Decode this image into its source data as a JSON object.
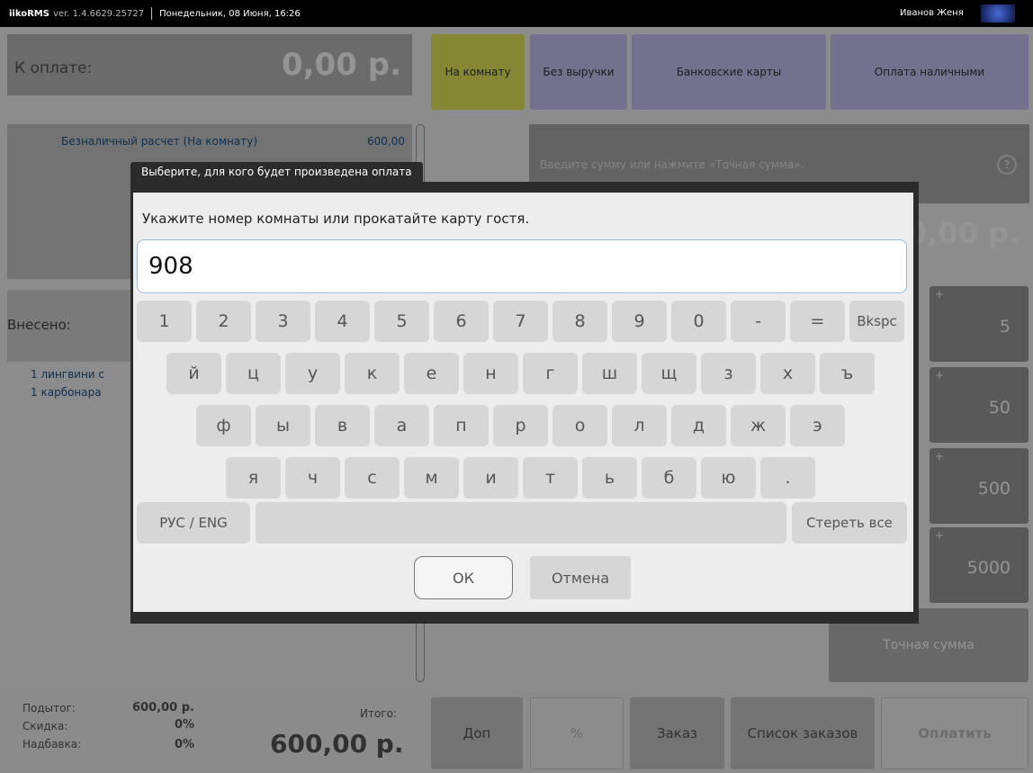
{
  "titlebar": {
    "app": "iikoRMS",
    "version": "ver. 1.4.6629.25727",
    "datetime": "Понедельник, 08 Июня, 16:26",
    "user": "Иванов Женя"
  },
  "payment": {
    "due_label": "К оплате:",
    "due_value": "0,00 р.",
    "methods": [
      "На комнату",
      "Без выручки",
      "Банковские карты",
      "Оплата наличными"
    ],
    "line_label": "Безналичный расчет (На комнату)",
    "line_amount": "600,00",
    "input_placeholder": "Введите сумму или нажмите «Точная сумма».",
    "help": "?",
    "amount": "0,00 р.",
    "paid_label": "Внесено:",
    "items": [
      {
        "qty": "1",
        "name": "лингвини с"
      },
      {
        "qty": "1",
        "name": "карбонара"
      }
    ],
    "quick": [
      {
        "plus": "+",
        "value": "5"
      },
      {
        "plus": "+",
        "value": "50"
      },
      {
        "plus": "+",
        "value": "500"
      },
      {
        "plus": "+",
        "value": "5000"
      }
    ],
    "exact": "Точная сумма"
  },
  "footer": {
    "subtotal_label": "Подытог:",
    "subtotal": "600,00 р.",
    "discount_label": "Скидка:",
    "discount": "0%",
    "surcharge_label": "Надбавка:",
    "surcharge": "0%",
    "total_label": "Итого:",
    "total": "600,00 р.",
    "buttons": [
      "Доп",
      "%",
      "Заказ",
      "Список заказов",
      "Оплатить"
    ]
  },
  "modal": {
    "title": "Выберите, для кого будет произведена оплата",
    "prompt": "Укажите номер комнаты или прокатайте карту гостя.",
    "value": "908",
    "row1": [
      "1",
      "2",
      "3",
      "4",
      "5",
      "6",
      "7",
      "8",
      "9",
      "0",
      "-",
      "=",
      "Bkspc"
    ],
    "row2": [
      "й",
      "ц",
      "у",
      "к",
      "е",
      "н",
      "г",
      "ш",
      "щ",
      "з",
      "х",
      "ъ"
    ],
    "row3": [
      "ф",
      "ы",
      "в",
      "а",
      "п",
      "р",
      "о",
      "л",
      "д",
      "ж",
      "э"
    ],
    "row4": [
      "я",
      "ч",
      "с",
      "м",
      "и",
      "т",
      "ь",
      "б",
      "ю",
      "."
    ],
    "lang": "РУС / ENG",
    "clear": "Стереть все",
    "ok": "ОК",
    "cancel": "Отмена"
  }
}
